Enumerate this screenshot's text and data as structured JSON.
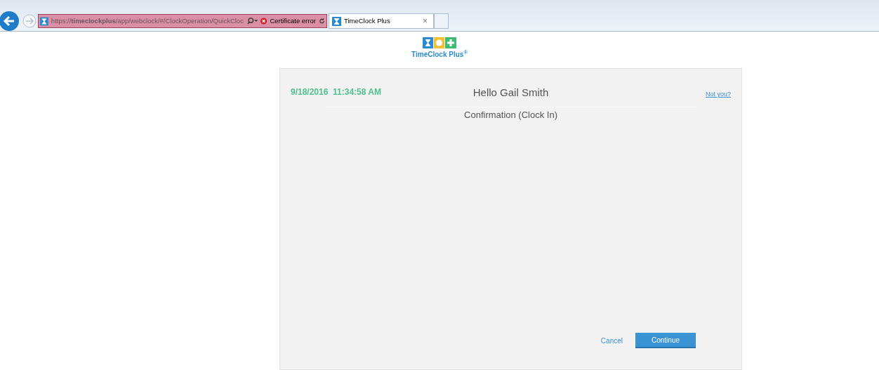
{
  "browser": {
    "address": "https://**timeclockplus**/app/webclock/#/ClockOperation/QuickCloc",
    "certificate": "Certificate error",
    "tab": {
      "title": "TimeClock Plus",
      "close": "×",
      "selected": true
    }
  },
  "logo": {
    "text": "TimeClock Plus$^{®}$"
  },
  "card": {
    "datetime": "9/18/2016  11:34:58 AM",
    "greeting": "Hello Gail Smith",
    "not_you": "Not you?",
    "subtitle": "Confirmation (Clock In)",
    "buttons": [
      {
        "label": "Cancel",
        "kind": "link"
      },
      {
        "label": "Continue",
        "kind": "primary"
      }
    ]
  }
}
